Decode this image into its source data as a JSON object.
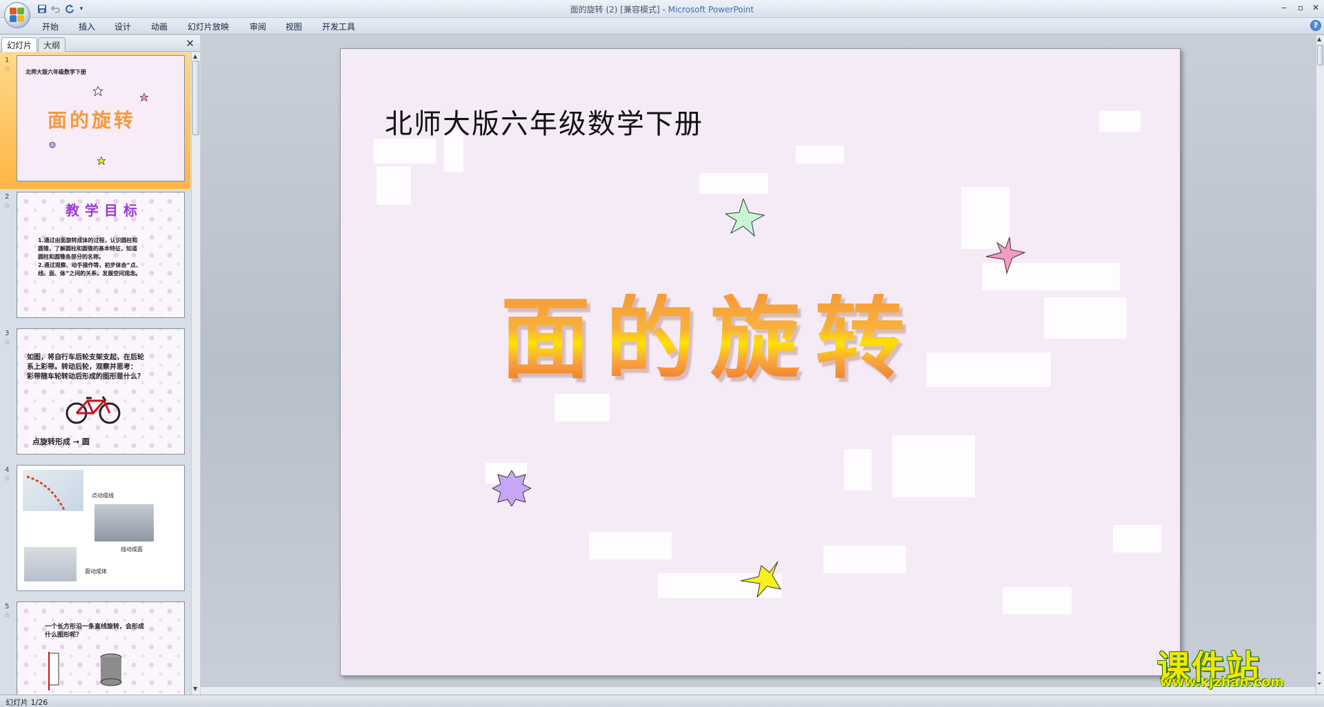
{
  "window": {
    "title_doc": "面的旋转 (2) [兼容模式]",
    "title_sep": " - ",
    "title_app": "Microsoft PowerPoint"
  },
  "ribbon": {
    "tabs": [
      "开始",
      "插入",
      "设计",
      "动画",
      "幻灯片放映",
      "审阅",
      "视图",
      "开发工具"
    ],
    "help": "?"
  },
  "pane": {
    "tabs": [
      "幻灯片",
      "大纲"
    ],
    "close": "✕"
  },
  "slides": [
    {
      "num": "1",
      "subtitle": "北师大版六年级数学下册",
      "title": "面的旋转"
    },
    {
      "num": "2",
      "heading": "教学目标",
      "lines": [
        "1.通过由面旋转成体的过程，认识圆柱和",
        "圆锥，了解圆柱和圆锥的基本特征，知道",
        "圆柱和圆锥各部分的名称。",
        "2.通过观察、动手操作等，初步体会“点、",
        "线、面、体”之间的关系，发展空间观念。"
      ]
    },
    {
      "num": "3",
      "lines": [
        "如图，将自行车后轮支架支起，在后轮",
        "系上彩带。转动后轮，观察并思考：",
        "彩带随车轮转动后形成的图形是什么？"
      ],
      "footer": "点旋转形成  →  圆"
    },
    {
      "num": "4",
      "captions": [
        "点动成线",
        "线动成面",
        "面动成体"
      ]
    },
    {
      "num": "5",
      "lines": [
        "一个长方形沿一条直线旋转，会形成",
        "什么图形呢？"
      ]
    }
  ],
  "main_slide": {
    "subtitle": "北师大版六年级数学下册",
    "title": "面的旋转",
    "colors": {
      "background": "#f5ebf7",
      "title_top": "#f79a3a",
      "title_mid": "#ffe200"
    }
  },
  "watermark": {
    "name": "课件站",
    "url": "www.kjzhan.com"
  },
  "status": {
    "slide_indicator": "幻灯片 1/26"
  }
}
